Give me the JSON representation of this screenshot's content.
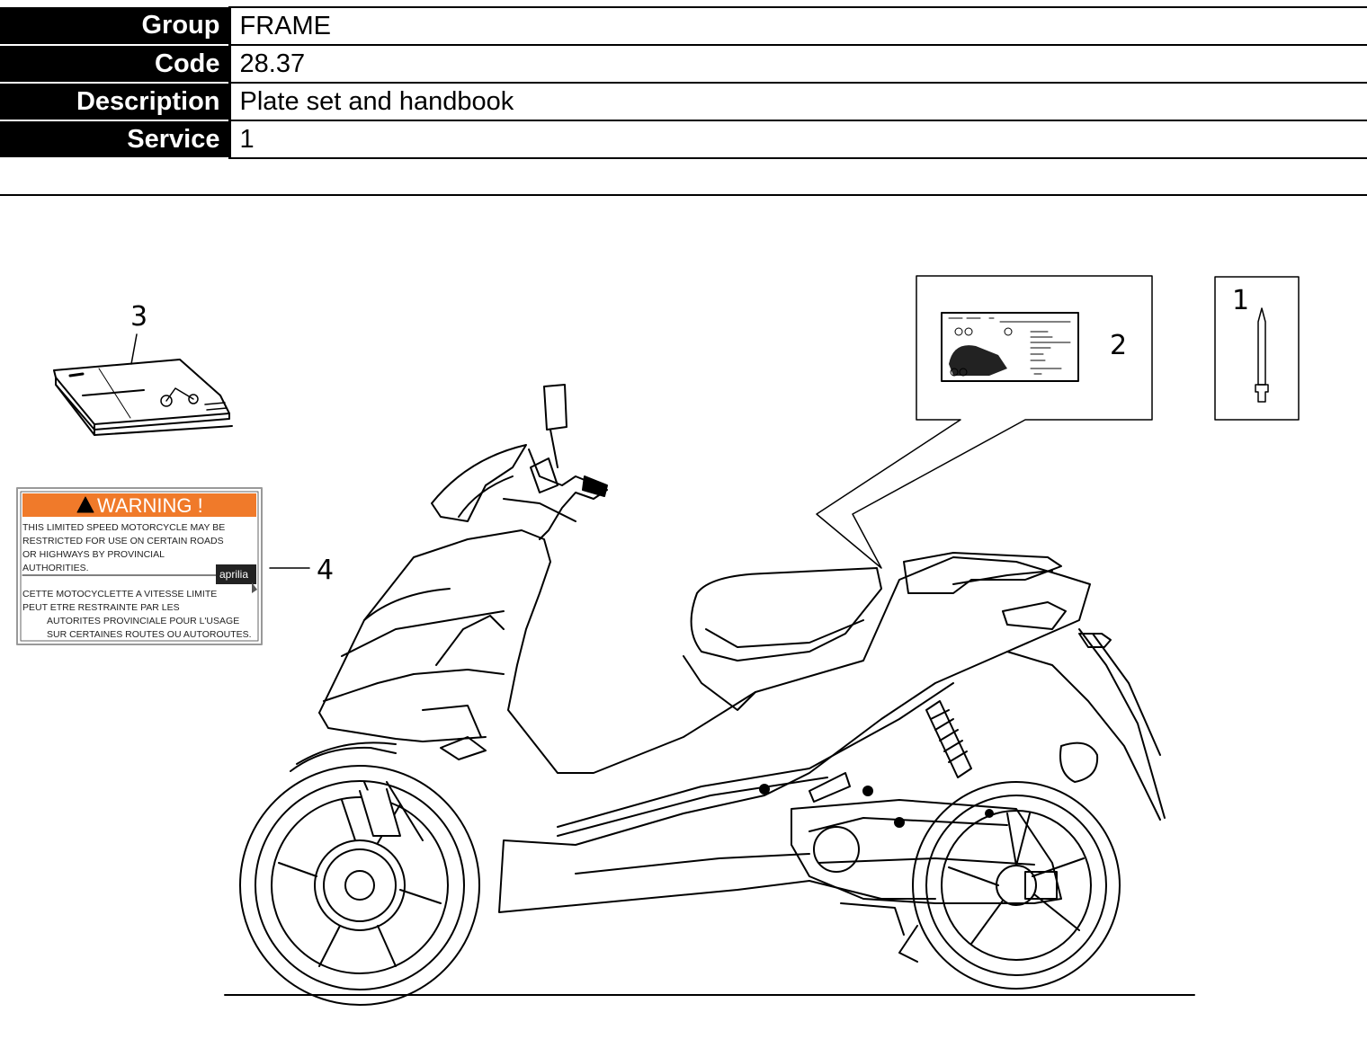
{
  "info": [
    {
      "label": "Group",
      "value": "FRAME"
    },
    {
      "label": "Code",
      "value": "28.37"
    },
    {
      "label": "Description",
      "value": "Plate set and handbook"
    },
    {
      "label": "Service",
      "value": "1"
    }
  ],
  "callouts": {
    "c1": "1",
    "c2": "2",
    "c3": "3",
    "c4": "4"
  },
  "warning_label": {
    "title": "WARNING !",
    "en_lines": [
      "THIS LIMITED SPEED MOTORCYCLE MAY BE",
      "RESTRICTED FOR USE ON CERTAIN ROADS",
      "OR HIGHWAYS BY PROVINCIAL",
      "AUTHORITIES."
    ],
    "fr_lines": [
      "CETTE MOTOCYCLETTE A VITESSE LIMITE",
      "PEUT ETRE RESTRAINTE PAR LES",
      "AUTORITES PROVINCIALE POUR L'USAGE",
      "SUR CERTAINES ROUTES OU AUTOROUTES."
    ],
    "brand": "aprilia",
    "header_color": "#f07a2a"
  }
}
